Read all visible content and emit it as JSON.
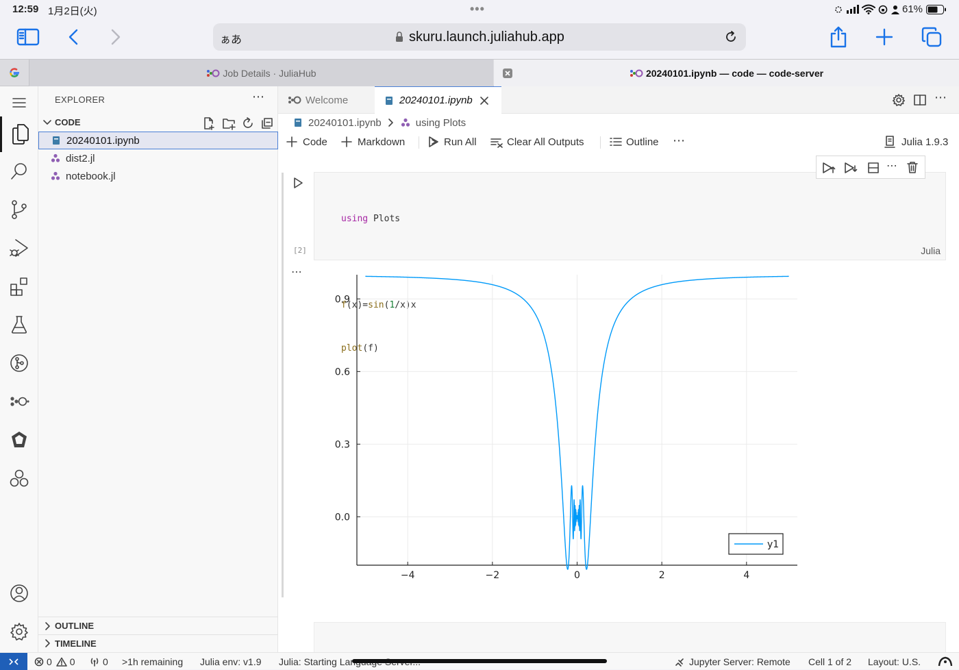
{
  "status": {
    "time": "12:59",
    "date": "1月2日(火)",
    "battery": "61%"
  },
  "browser": {
    "url_prefix": "ぁあ",
    "url": "skuru.launch.juliahub.app",
    "tabs": [
      {
        "label": "Job Details · JuliaHub"
      },
      {
        "label": "20240101.ipynb — code — code-server"
      }
    ]
  },
  "sidebar": {
    "title": "EXPLORER",
    "folder": "CODE",
    "files": [
      {
        "name": "20240101.ipynb"
      },
      {
        "name": "dist2.jl"
      },
      {
        "name": "notebook.jl"
      }
    ],
    "outline": "OUTLINE",
    "timeline": "TIMELINE"
  },
  "editor": {
    "tabs": [
      {
        "label": "Welcome"
      },
      {
        "label": "20240101.ipynb"
      }
    ],
    "breadcrumb": [
      "20240101.ipynb",
      "using Plots"
    ],
    "toolbar": {
      "code": "Code",
      "markdown": "Markdown",
      "run_all": "Run All",
      "clear": "Clear All Outputs",
      "outline": "Outline",
      "kernel": "Julia 1.9.3"
    },
    "cell": {
      "exec_count": "[2]",
      "language": "Julia",
      "lines": {
        "l1_kw": "using",
        "l1_rest": " Plots",
        "l3_f": "f",
        "l3_a": "(x)=",
        "l3_sin": "sin",
        "l3_b": "(",
        "l3_one": "1",
        "l3_c": "/x)x",
        "l4_plot": "plot",
        "l4_rest": "(f)"
      },
      "output_more": "⋯"
    }
  },
  "chart_data": {
    "type": "line",
    "function": "f(x)=sin(1/x)x",
    "xlim": [
      -5.2,
      5.2
    ],
    "ylim": [
      -0.2,
      1.0
    ],
    "xticks": [
      -4,
      -2,
      0,
      2,
      4
    ],
    "xtick_labels": [
      "−4",
      "−2",
      "0",
      "2",
      "4"
    ],
    "yticks": [
      0.0,
      0.3,
      0.6,
      0.9
    ],
    "ytick_labels": [
      "0.0",
      "0.3",
      "0.6",
      "0.9"
    ],
    "x_domain": [
      -5,
      5
    ],
    "grid": true,
    "legend_position": "bottom-right",
    "series": [
      {
        "name": "y1",
        "color": "#009af9"
      }
    ]
  },
  "statusline": {
    "errors": "0",
    "warnings": "0",
    "ports": "0",
    "remaining": ">1h remaining",
    "env": "Julia env: v1.9",
    "lsp": "Julia: Starting Language Server...",
    "jupyter": "Jupyter Server: Remote",
    "cell": "Cell 1 of 2",
    "layout": "Layout: U.S."
  }
}
